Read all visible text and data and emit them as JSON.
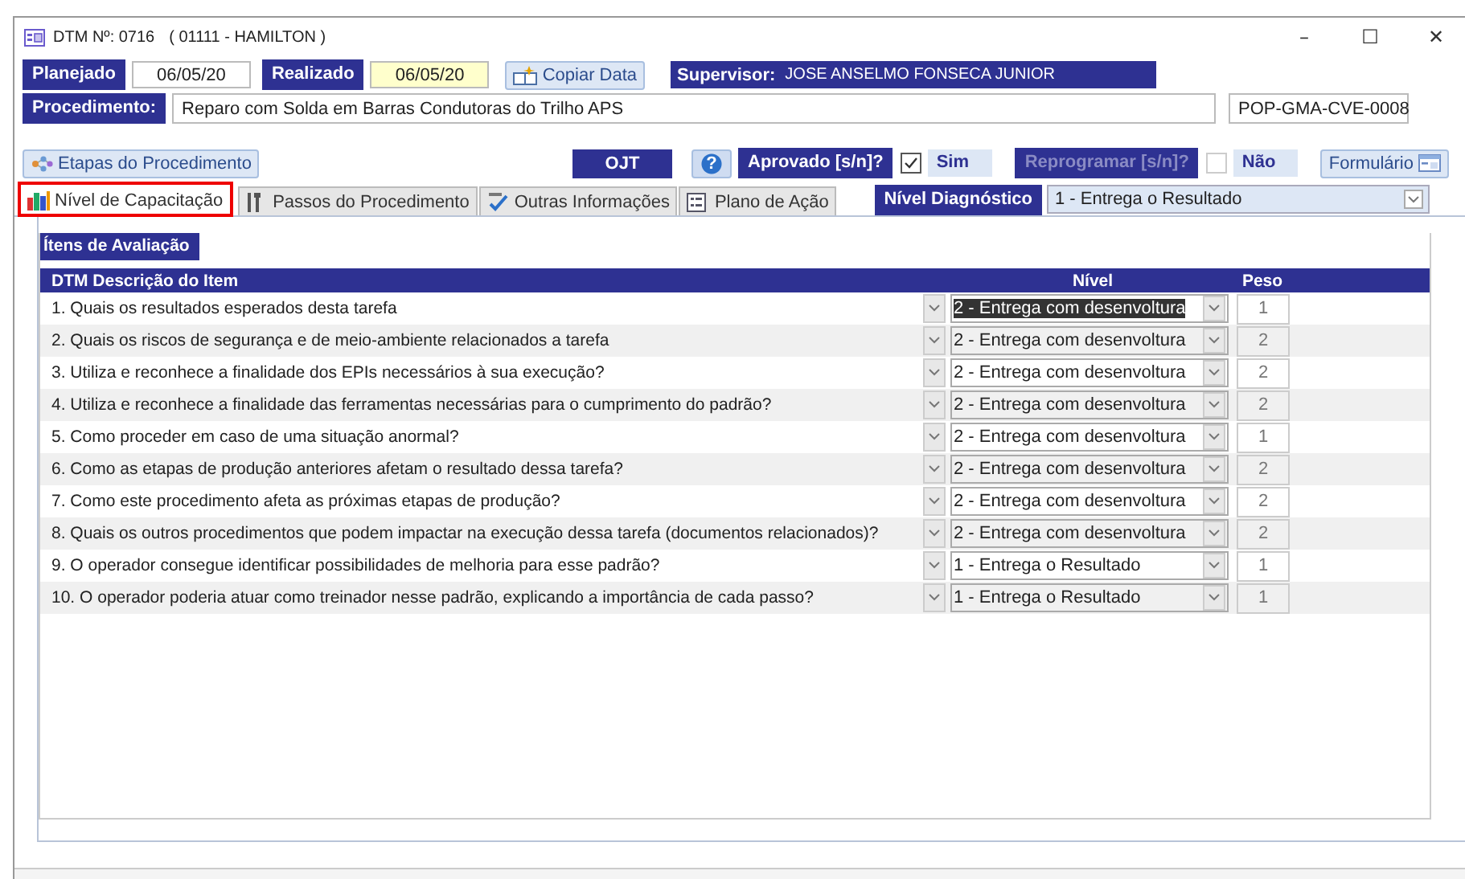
{
  "window": {
    "title": "DTM Nº: 0716",
    "subtitle": "( 01111 - HAMILTON )",
    "controls": [
      "–",
      "☐",
      "✕"
    ]
  },
  "header": {
    "planejado": {
      "label": "Planejado",
      "value": "06/05/20"
    },
    "realizado": {
      "label": "Realizado",
      "value": "06/05/20"
    },
    "copy_button": "Copiar Data",
    "supervisor": {
      "label": "Supervisor:",
      "value": "JOSE ANSELMO FONSECA JUNIOR"
    },
    "procedimento": {
      "label": "Procedimento:",
      "value": "Reparo com Solda em Barras Condutoras do Trilho APS",
      "code": "POP-GMA-CVE-0008"
    }
  },
  "toolbar": {
    "etapas_button": "Etapas do Procedimento",
    "ojt_button": "OJT",
    "help_button": "?",
    "aprovado": {
      "label": "Aprovado [s/n]?",
      "checked": true,
      "answer": "Sim",
      "disabled": false
    },
    "reprogramar": {
      "label": "Reprogramar [s/n]?",
      "checked": false,
      "answer": "Não",
      "disabled": true
    },
    "form_button": "Formulário"
  },
  "tabs": [
    {
      "label": "Nível de Capacitação",
      "selected": true
    },
    {
      "label": "Passos do Procedimento",
      "selected": false
    },
    {
      "label": "Outras Informações",
      "selected": false
    },
    {
      "label": "Plano de Ação",
      "selected": false
    }
  ],
  "diagnostico": {
    "label": "Nível Diagnóstico",
    "value": "1 - Entrega o Resultado"
  },
  "section_title": "Ítens de Avaliação",
  "table": {
    "columns": [
      "DTM  Descrição do Item",
      "Nível",
      "Peso"
    ],
    "rows": [
      {
        "description": "1. Quais os resultados esperados desta tarefa",
        "nivel": "2 - Entrega com desenvoltura",
        "peso": "1",
        "selected": true
      },
      {
        "description": "2. Quais os riscos de segurança e de meio-ambiente relacionados a tarefa",
        "nivel": "2 - Entrega com desenvoltura",
        "peso": "2",
        "selected": false
      },
      {
        "description": "3. Utiliza  e reconhece a finalidade dos EPIs necessários à sua execução?",
        "nivel": "2 - Entrega com desenvoltura",
        "peso": "2",
        "selected": false
      },
      {
        "description": "4. Utiliza  e reconhece a finalidade das ferramentas necessárias para o cumprimento do padrão?",
        "nivel": "2 - Entrega com desenvoltura",
        "peso": "2",
        "selected": false
      },
      {
        "description": "5. Como proceder em caso de uma situação anormal?",
        "nivel": "2 - Entrega com desenvoltura",
        "peso": "1",
        "selected": false
      },
      {
        "description": "6. Como as etapas de produção anteriores afetam o resultado dessa tarefa?",
        "nivel": "2 - Entrega com desenvoltura",
        "peso": "2",
        "selected": false
      },
      {
        "description": "7. Como este procedimento afeta as próximas etapas de produção?",
        "nivel": "2 - Entrega com desenvoltura",
        "peso": "2",
        "selected": false
      },
      {
        "description": "8. Quais os outros procedimentos que podem impactar na execução dessa tarefa (documentos relacionados)?",
        "nivel": "2 - Entrega com desenvoltura",
        "peso": "2",
        "selected": false
      },
      {
        "description": "9. O operador consegue identificar possibilidades de melhoria para esse padrão?",
        "nivel": "1 - Entrega o Resultado",
        "peso": "1",
        "selected": false
      },
      {
        "description": "10. O operador poderia atuar como treinador nesse padrão, explicando a importância de cada passo?",
        "nivel": "1 - Entrega o Resultado",
        "peso": "1",
        "selected": false
      }
    ]
  }
}
